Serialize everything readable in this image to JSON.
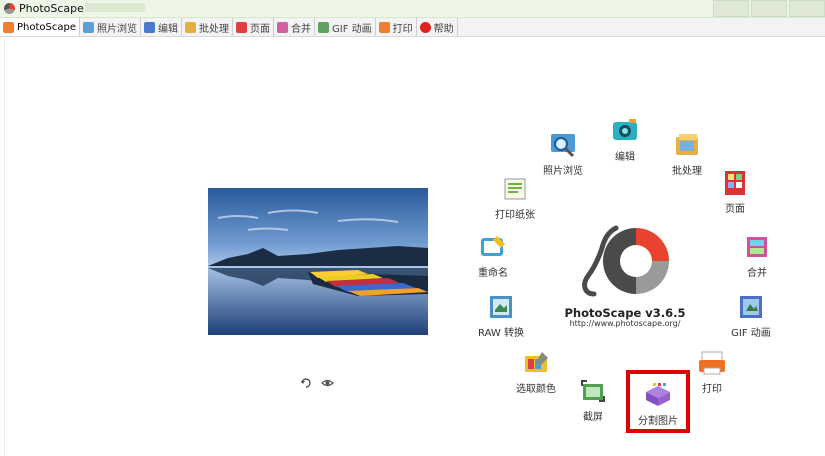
{
  "window": {
    "title": "PhotoScape",
    "controls": [
      "ctrl1",
      "ctrl2",
      "ctrl3"
    ]
  },
  "tabs": [
    {
      "label": "PhotoScape",
      "icon": "photoscape-icon",
      "color": "#f08030"
    },
    {
      "label": "照片浏览",
      "icon": "viewer-icon",
      "color": "#5aa0d8"
    },
    {
      "label": "编辑",
      "icon": "editor-icon",
      "color": "#4a7ad0"
    },
    {
      "label": "批处理",
      "icon": "batch-icon",
      "color": "#e0b040"
    },
    {
      "label": "页面",
      "icon": "page-icon",
      "color": "#e04040"
    },
    {
      "label": "合并",
      "icon": "combine-icon",
      "color": "#d060a0"
    },
    {
      "label": "GIF 动画",
      "icon": "gif-icon",
      "color": "#60a060"
    },
    {
      "label": "打印",
      "icon": "print-icon",
      "color": "#f08030"
    },
    {
      "label": "帮助",
      "icon": "help-icon",
      "color": "#e02020"
    }
  ],
  "launcher": {
    "items": [
      {
        "label": "照片浏览",
        "icon": "viewer-icon",
        "color": "#4a9ad8"
      },
      {
        "label": "编辑",
        "icon": "editor-icon",
        "color": "#2ab0c0"
      },
      {
        "label": "批处理",
        "icon": "batch-icon",
        "color": "#e8b040"
      },
      {
        "label": "页面",
        "icon": "page-icon",
        "color": "#e03030"
      },
      {
        "label": "合并",
        "icon": "combine-icon",
        "color": "#d050a0"
      },
      {
        "label": "GIF 动画",
        "icon": "gif-icon",
        "color": "#4a70c8"
      },
      {
        "label": "打印",
        "icon": "print-icon",
        "color": "#f07020"
      },
      {
        "label": "分割图片",
        "icon": "splitter-icon",
        "color": "#9a60d0"
      },
      {
        "label": "截屏",
        "icon": "screen-capture-icon",
        "color": "#50a050"
      },
      {
        "label": "选取颜色",
        "icon": "color-picker-icon",
        "color": "#e8c030"
      },
      {
        "label": "RAW 转换",
        "icon": "raw-converter-icon",
        "color": "#4a90c0"
      },
      {
        "label": "重命名",
        "icon": "rename-icon",
        "color": "#40a0d8"
      },
      {
        "label": "打印纸张",
        "icon": "paper-print-icon",
        "color": "#70b040"
      }
    ],
    "selected": "分割图片"
  },
  "brand": {
    "name": "PhotoScape v3.6.5",
    "url": "http://www.photoscape.org/"
  },
  "colors": {
    "logo_red": "#e8432f",
    "logo_gray": "#9a9a9a",
    "logo_dark": "#4a4a4a",
    "highlight": "#e00000"
  }
}
